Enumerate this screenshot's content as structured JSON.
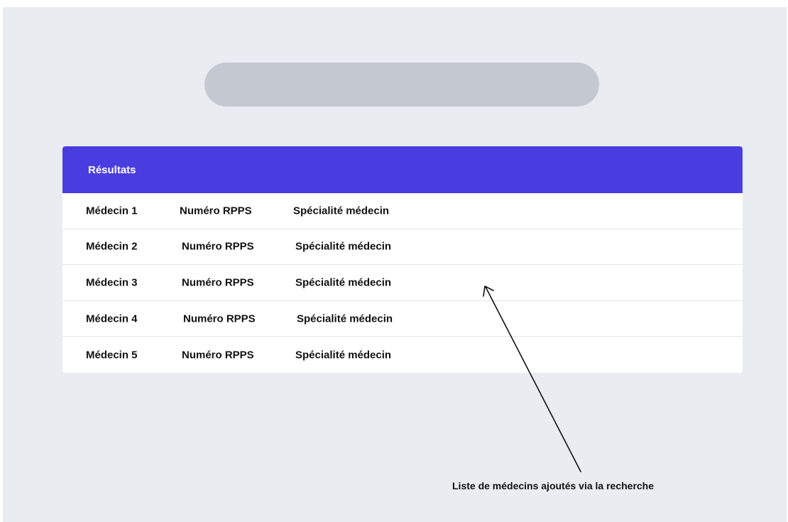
{
  "results": {
    "title": "Résultats",
    "rows": [
      {
        "doctor": "Médecin 1",
        "rpps": "Numéro RPPS",
        "specialty": "Spécialité médecin"
      },
      {
        "doctor": "Médecin 2",
        "rpps": "Numéro RPPS",
        "specialty": "Spécialité médecin"
      },
      {
        "doctor": "Médecin 3",
        "rpps": "Numéro RPPS",
        "specialty": "Spécialité médecin"
      },
      {
        "doctor": "Médecin 4",
        "rpps": "Numéro RPPS",
        "specialty": "Spécialité médecin"
      },
      {
        "doctor": "Médecin 5",
        "rpps": "Numéro RPPS",
        "specialty": "Spécialité médecin"
      }
    ]
  },
  "annotation": {
    "text": "Liste de médecins ajoutés via la recherche"
  },
  "colors": {
    "background": "#e9ecf1",
    "search_bar": "#c4c8d1",
    "header_accent": "#4a3de0",
    "panel": "#ffffff"
  }
}
